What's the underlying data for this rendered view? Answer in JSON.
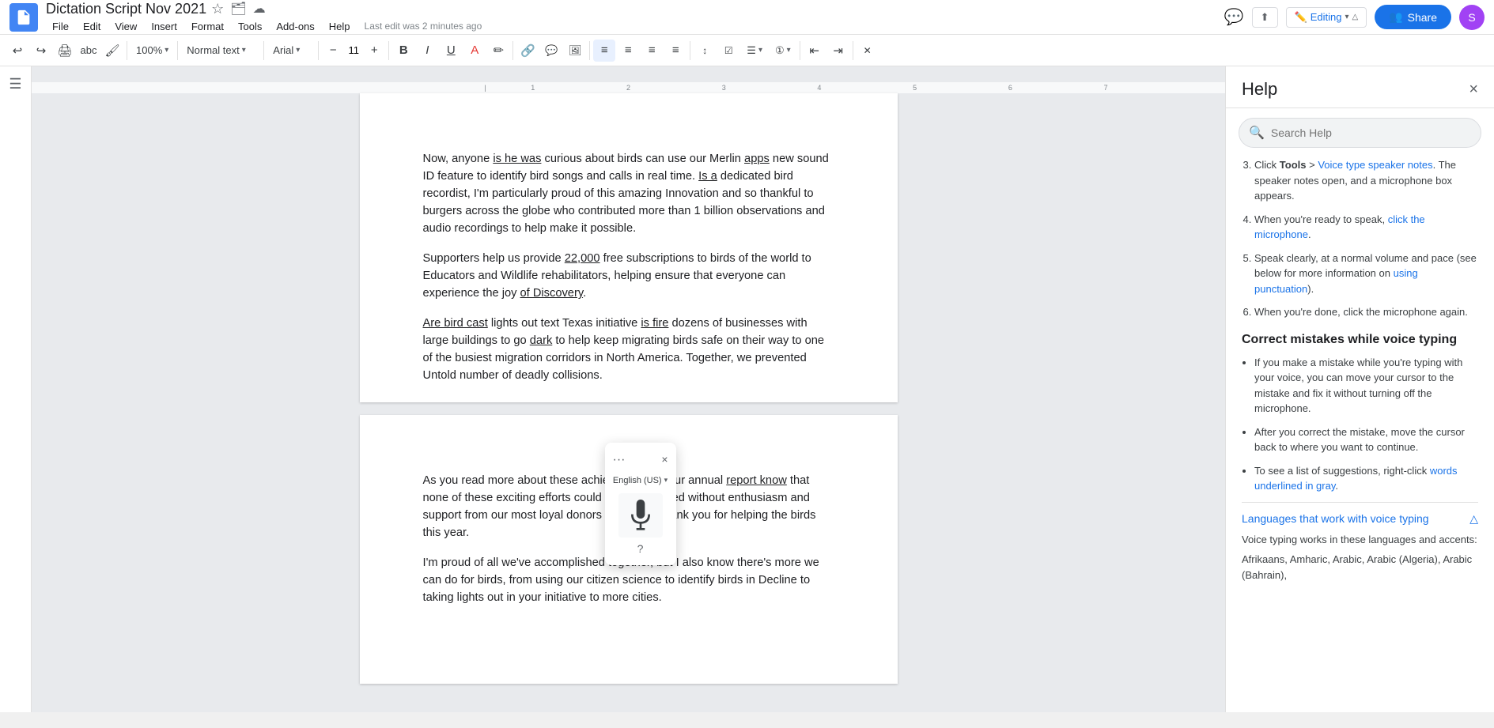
{
  "app": {
    "icon_label": "Docs",
    "title": "Dictation Script Nov 2021"
  },
  "title_icons": {
    "star": "☆",
    "folder": "📁",
    "cloud": "☁"
  },
  "menu": {
    "items": [
      "File",
      "Edit",
      "View",
      "Insert",
      "Format",
      "Tools",
      "Add-ons",
      "Help"
    ]
  },
  "last_edit": "Last edit was 2 minutes ago",
  "top_right": {
    "share_label": "Share",
    "editing_label": "Editing",
    "avatar_letter": "S"
  },
  "toolbar": {
    "zoom": "100%",
    "style": "Normal text",
    "font": "Arial",
    "font_size": "11",
    "undo_label": "Undo",
    "redo_label": "Redo",
    "print_label": "Print",
    "spell_label": "Spell check",
    "paint_label": "Paint format",
    "bold_label": "Bold",
    "italic_label": "Italic",
    "underline_label": "Underline",
    "color_label": "Text color",
    "highlight_label": "Highlight",
    "link_label": "Insert link",
    "comment_label": "Insert comment",
    "image_label": "Insert image",
    "align_left_label": "Align left",
    "align_center_label": "Align center",
    "align_right_label": "Align right",
    "justify_label": "Justify",
    "line_spacing_label": "Line spacing",
    "checklist_label": "Checklist",
    "bullet_label": "Bullet list",
    "numbered_label": "Numbered list",
    "indent_dec_label": "Decrease indent",
    "indent_inc_label": "Increase indent",
    "clear_label": "Clear formatting"
  },
  "pages": [
    {
      "paragraphs": [
        "Now, anyone is he was curious about birds can use our Merlin apps new sound ID feature to identify bird songs and calls in real time. Is a dedicated bird recordist, I'm particularly proud of this amazing Innovation and so thankful to burgers across the globe who contributed more than 1 billion observations and audio recordings to help make it possible.",
        "Supporters help us provide 22,000 free subscriptions to birds of the world to Educators and Wildlife rehabilitators, helping ensure that everyone can experience the joy of Discovery.",
        "Are bird cast lights out text Texas initiative is fire dozens of businesses with large buildings to go dark to help keep migrating birds safe on their way to one of the busiest migration corridors in North America. Together, we prevented Untold number of deadly collisions."
      ]
    },
    {
      "paragraphs": [
        "As you read more about these achievements in our annual report know that none of these exciting efforts could have happened without enthusiasm and support from our most loyal donors like you to thank you for helping the birds this year.",
        "I'm proud of all we've accomplished together, but I also know there's more we can do for birds, from using our citizen science to identify birds in Decline to taking lights out in your initiative to more cities."
      ]
    }
  ],
  "voice_widget": {
    "language": "English (US)",
    "close_label": "×",
    "help_label": "?",
    "dots_label": "···"
  },
  "help": {
    "title": "Help",
    "search_placeholder": "Search Help",
    "steps": [
      {
        "number": "3",
        "text": "Click Tools > Voice type speaker notes. The speaker notes open, and a microphone box appears.",
        "link_text": "Voice type speaker notes"
      },
      {
        "number": "4",
        "text": "When you're ready to speak, click the microphone.",
        "link_text": "click the microphone"
      },
      {
        "number": "5",
        "text": "Speak clearly, at a normal volume and pace (see below for more information on using punctuation).",
        "link_text": "using punctuation"
      },
      {
        "number": "6",
        "text": "When you're done, click the microphone again.",
        "link_text": "click the microphone again"
      }
    ],
    "correct_heading": "Correct mistakes while voice typing",
    "correct_items": [
      {
        "text": "If you make a mistake while you're typing with your voice, you can move your cursor to the mistake and fix it without turning off the microphone.",
        "link_text": ""
      },
      {
        "text": "After you correct the mistake, move the cursor back to where you want to continue.",
        "link_text": ""
      },
      {
        "text": "To see a list of suggestions, right-click words underlined in gray.",
        "link_text": "words underlined in gray"
      }
    ],
    "languages_heading": "Languages that work with voice typing",
    "languages_intro": "Voice typing works in these languages and accents:",
    "languages_list": "Afrikaans, Amharic, Arabic, Arabic (Algeria), Arabic (Bahrain),"
  }
}
